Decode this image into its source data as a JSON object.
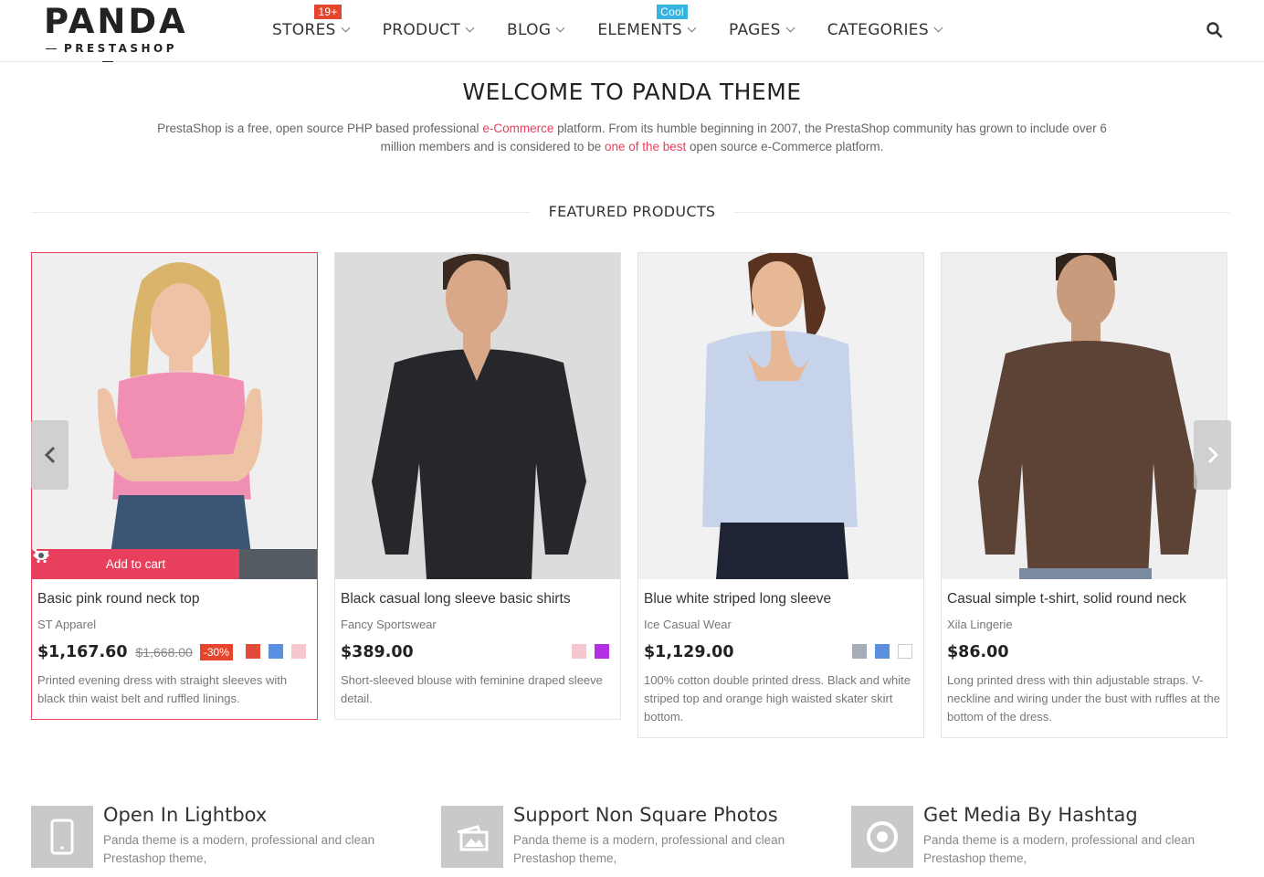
{
  "header": {
    "logo_main": "PANDA",
    "logo_sub": "PRESTASHOP",
    "nav": [
      {
        "label": "STORES",
        "badge": "19+"
      },
      {
        "label": "PRODUCT",
        "badge": ""
      },
      {
        "label": "BLOG",
        "badge": ""
      },
      {
        "label": "ELEMENTS",
        "badge": "Cool"
      },
      {
        "label": "PAGES",
        "badge": ""
      },
      {
        "label": "CATEGORIES",
        "badge": ""
      }
    ],
    "search_icon": "search-icon"
  },
  "welcome": {
    "title": "WELCOME TO PANDA THEME",
    "text_1": "PrestaShop is a free, open source PHP based professional ",
    "link_1": "e-Commerce",
    "text_2": " platform. From its humble beginning in 2007, the PrestaShop community has grown to include over 6 million members and is considered to be ",
    "link_2": "one of the best",
    "text_3": " open source e-Commerce platform."
  },
  "featured": {
    "title": "FEATURED PRODUCTS",
    "add_to_cart": "Add to cart",
    "products": [
      {
        "name": "Basic pink round neck top",
        "brand": "ST Apparel",
        "price": "$1,167.60",
        "old_price": "$1,668.00",
        "discount": "-30%",
        "swatches": [
          "#e04b3a",
          "#5b8fe0",
          "#f6c7cf"
        ],
        "description": "Printed evening dress with straight sleeves with black thin waist belt and ruffled linings."
      },
      {
        "name": "Black casual long sleeve basic shirts",
        "brand": "Fancy Sportswear",
        "price": "$389.00",
        "old_price": "",
        "discount": "",
        "swatches": [
          "#f6c7cf",
          "#b42ee6"
        ],
        "description": "Short-sleeved blouse with feminine draped sleeve detail."
      },
      {
        "name": "Blue white striped long sleeve",
        "brand": "Ice Casual Wear",
        "price": "$1,129.00",
        "old_price": "",
        "discount": "",
        "swatches": [
          "#a5adb8",
          "#5b8fe0",
          "#ffffff"
        ],
        "description": "100% cotton double printed dress. Black and white striped top and orange high waisted skater skirt bottom."
      },
      {
        "name": "Casual simple t-shirt, solid round neck",
        "brand": "Xila Lingerie",
        "price": "$86.00",
        "old_price": "",
        "discount": "",
        "swatches": [],
        "description": "Long printed dress with thin adjustable straps. V-neckline and wiring under the bust with ruffles at the bottom of the dress."
      }
    ]
  },
  "features": [
    {
      "title": "Open In Lightbox",
      "text": "Panda theme is a modern, professional and clean Prestashop theme,",
      "icon": "mobile-icon"
    },
    {
      "title": "Support Non Square Photos",
      "text": "Panda theme is a modern, professional and clean Prestashop theme,",
      "icon": "photos-icon"
    },
    {
      "title": "Get Media By Hashtag",
      "text": "Panda theme is a modern, professional and clean Prestashop theme,",
      "icon": "target-icon"
    }
  ],
  "colors": {
    "accent": "#e8405c",
    "badge_red": "#e5452c",
    "badge_blue": "#35b4e0",
    "dark_button": "#555b62"
  }
}
